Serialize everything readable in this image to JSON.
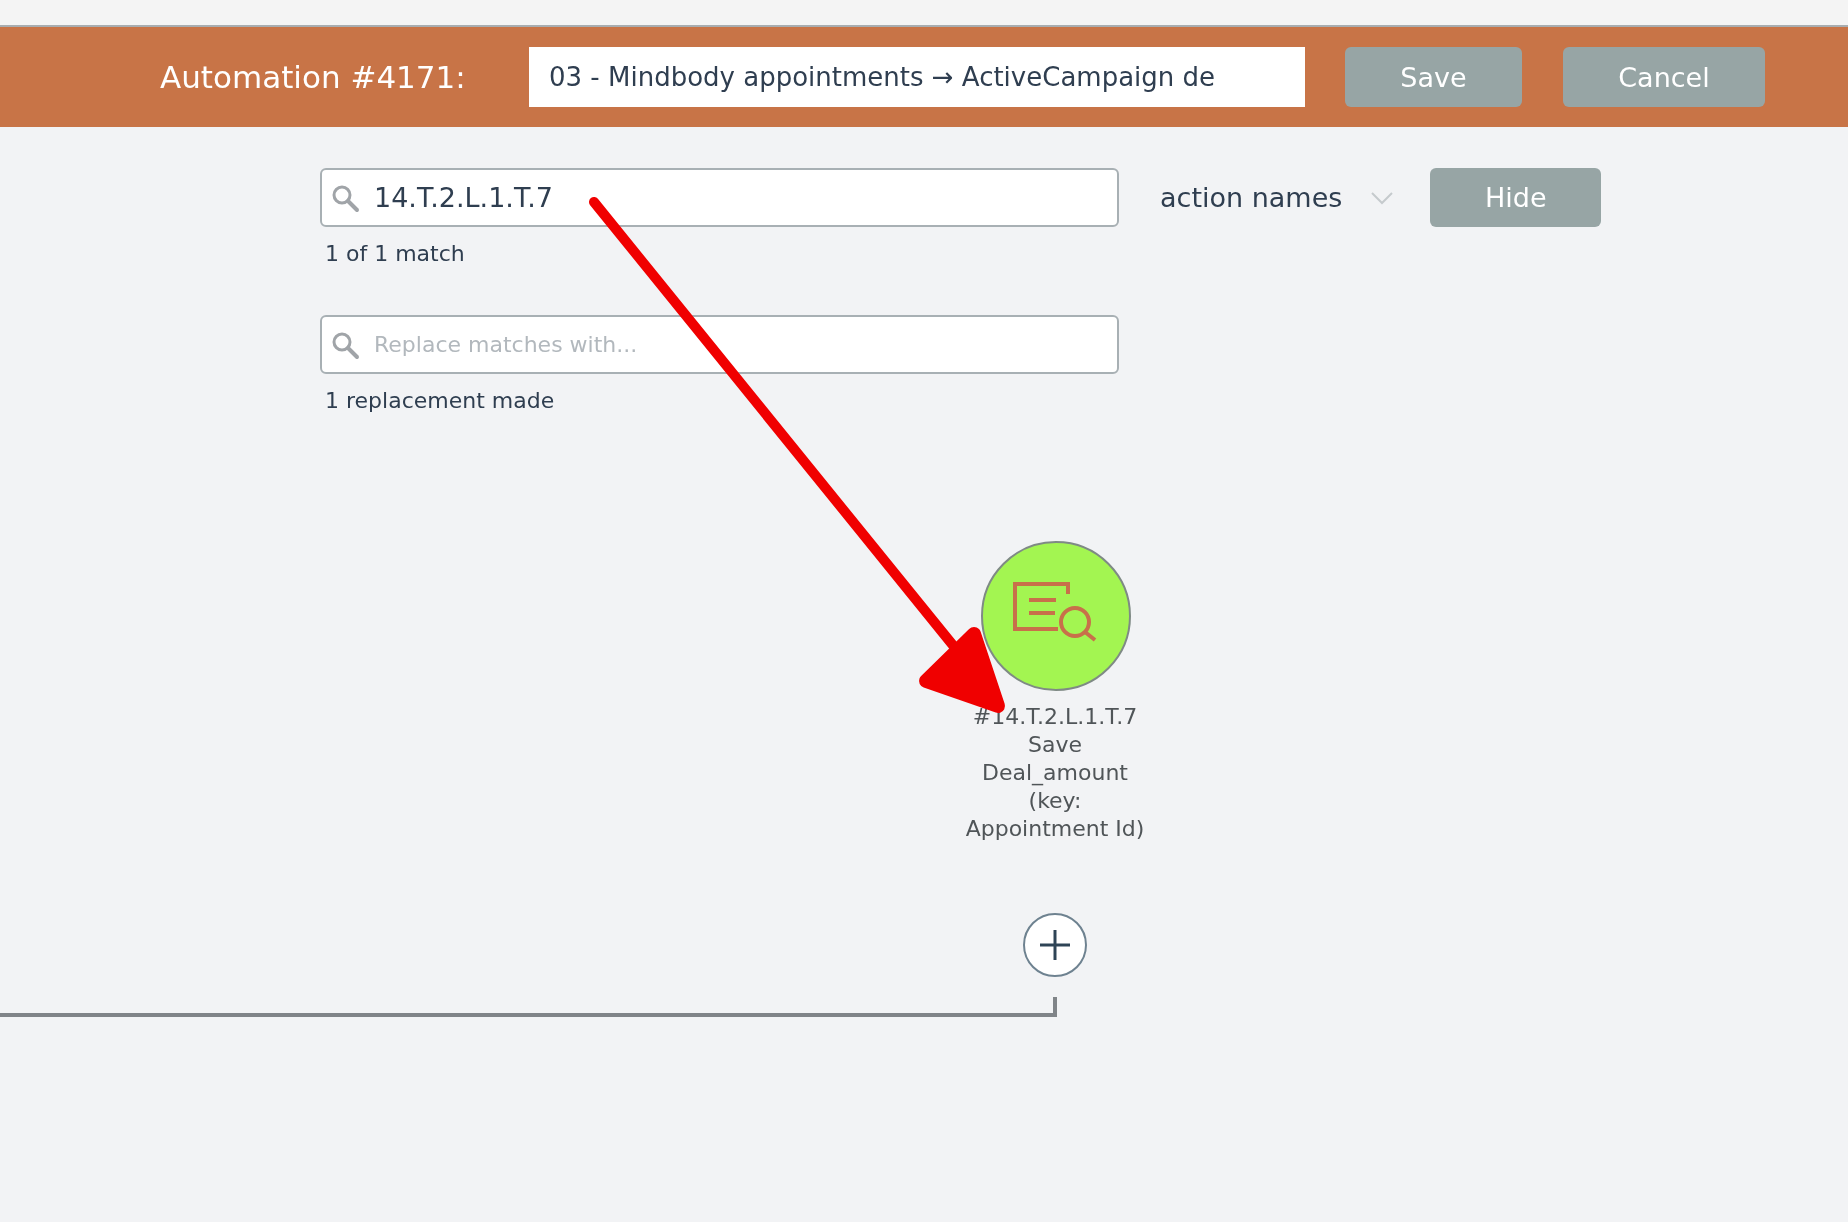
{
  "header": {
    "title": "Automation #4171:",
    "name_field": {
      "value": "03 - Mindbody appointments → ActiveCampaign de"
    },
    "buttons": [
      {
        "label": "Save"
      },
      {
        "label": "Cancel"
      }
    ]
  },
  "search": {
    "field": {
      "value": "14.T.2.L.1.T.7"
    },
    "status": "1 of 1 match",
    "scope": "action names",
    "hide_button": "Hide",
    "replace_field": {
      "placeholder": "Replace matches with..."
    },
    "replace_status": "1 replacement made"
  },
  "canvas": {
    "node": {
      "label": "#14.T.2.L.1.T.7 Save Deal_amount (key: Appointment Id)"
    }
  }
}
